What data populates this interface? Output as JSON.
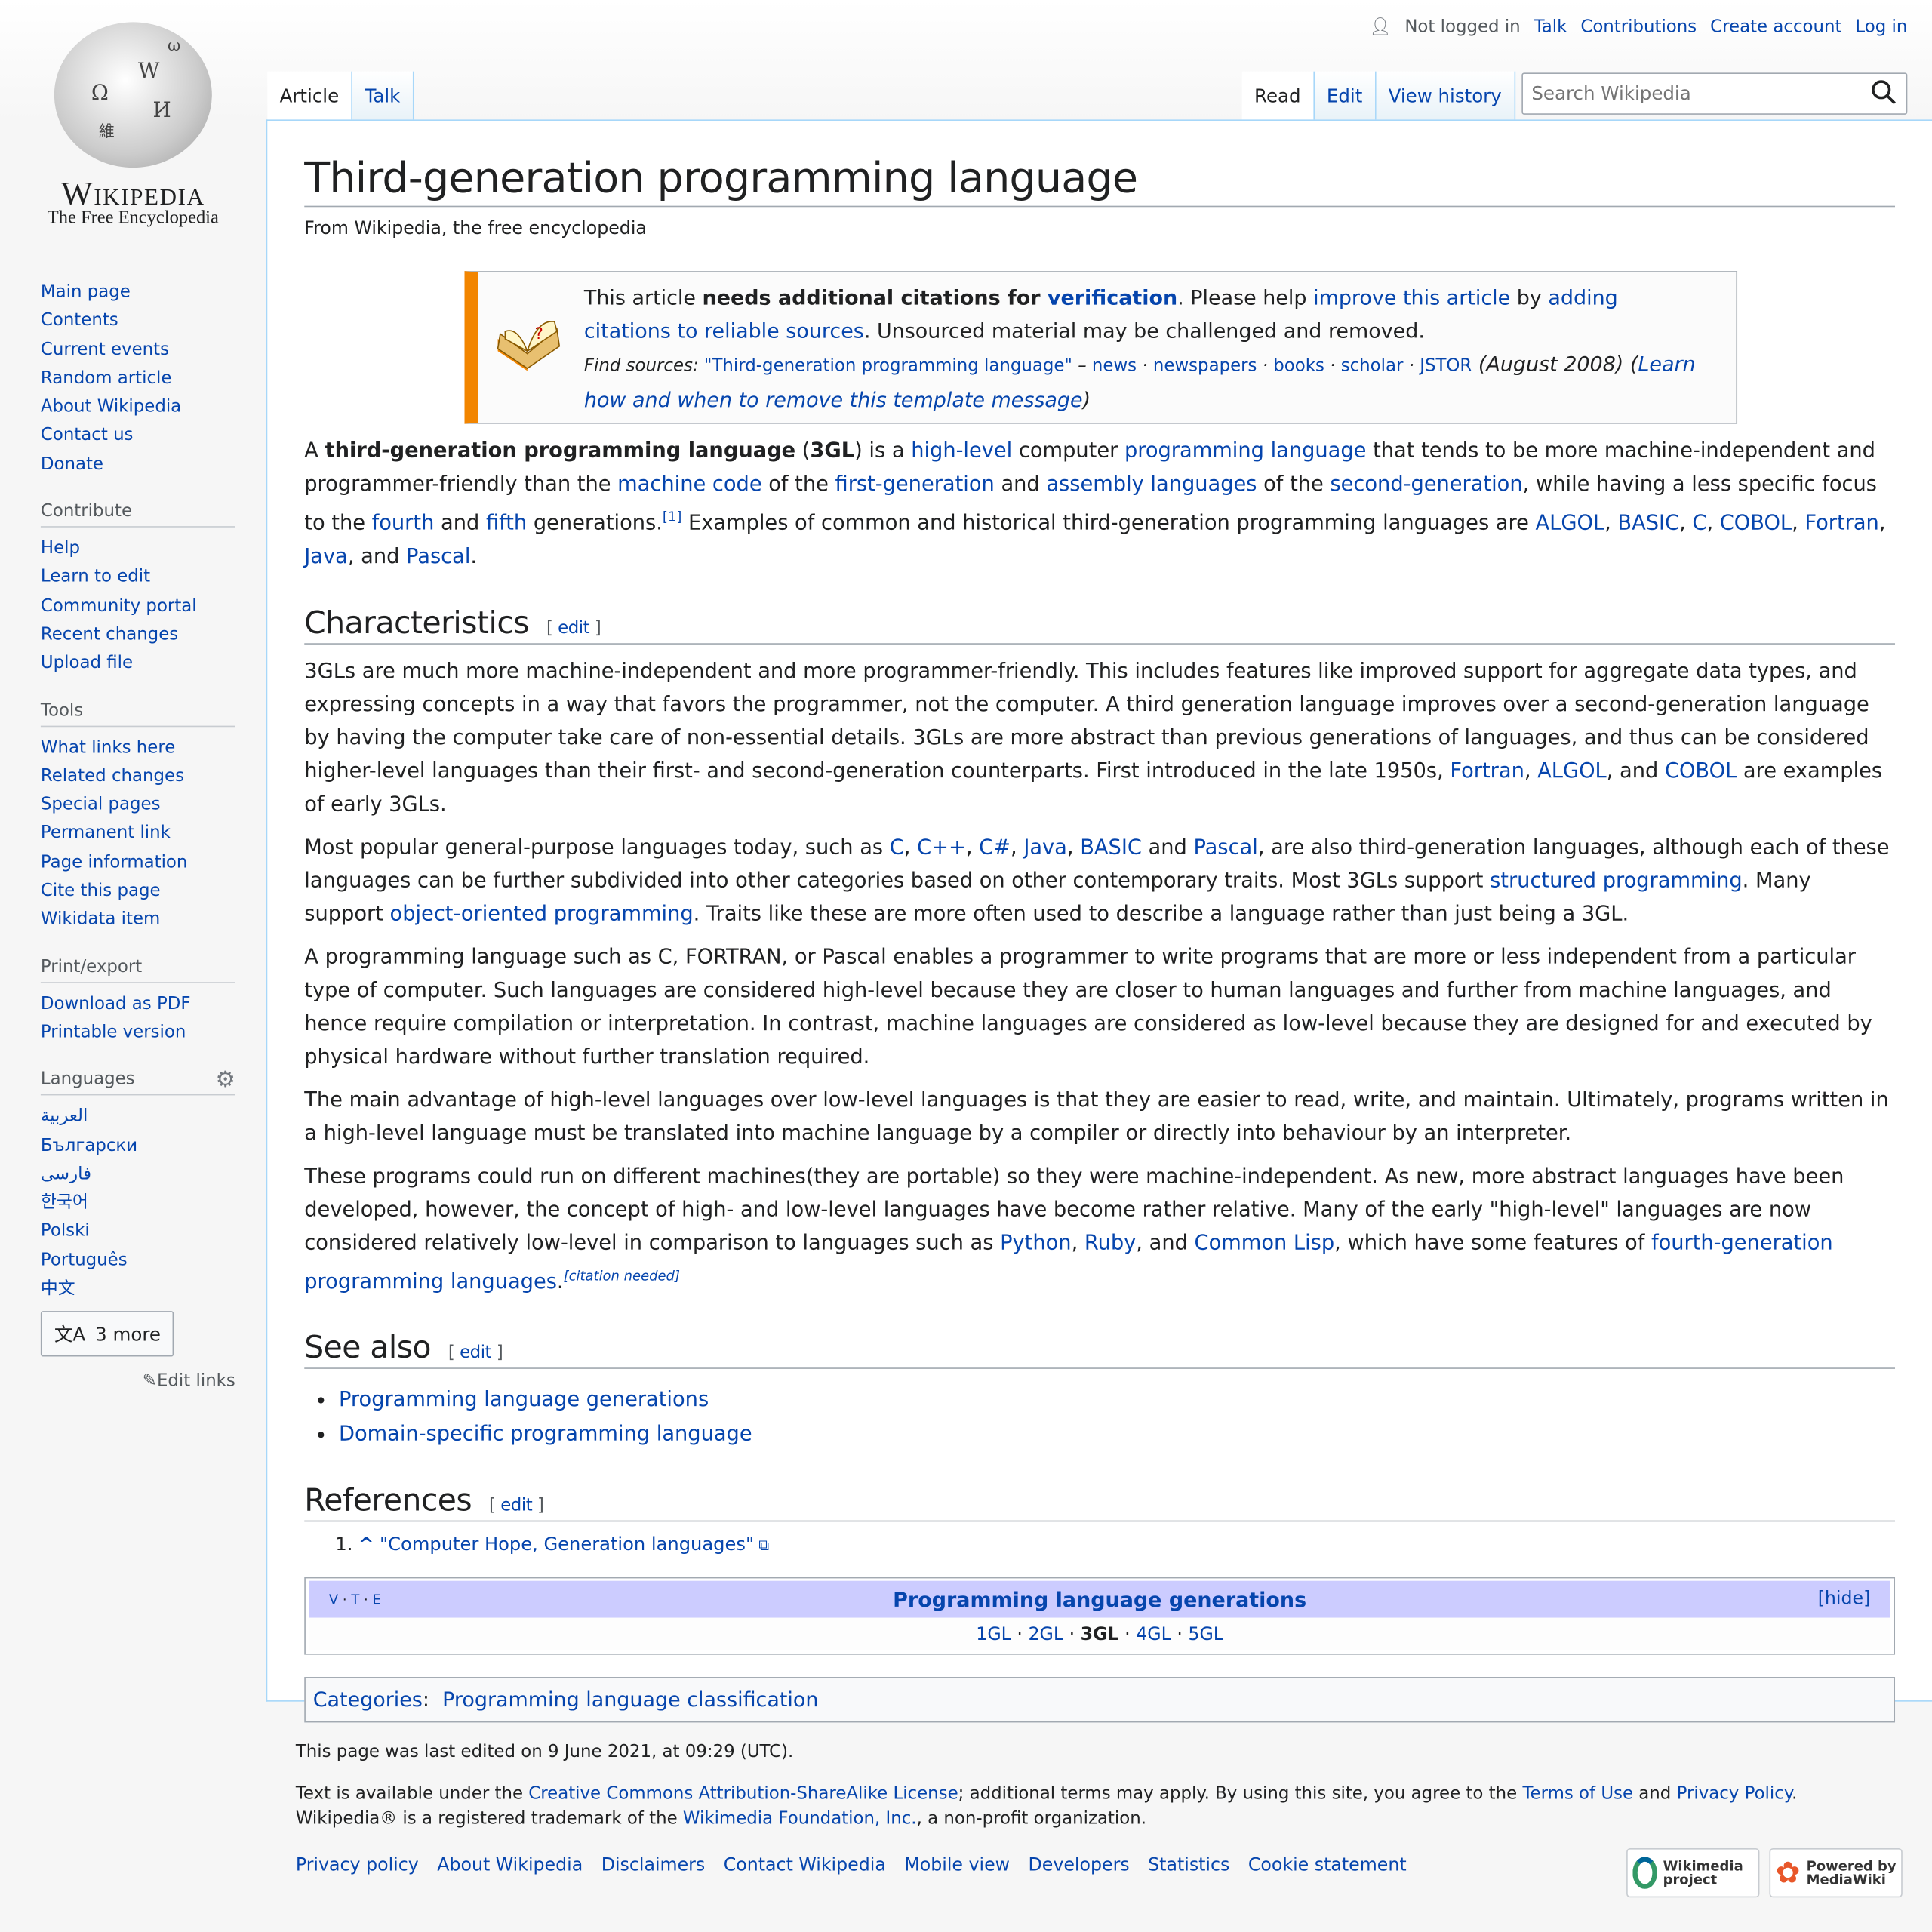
{
  "logo": {
    "wordmark": "Wikipedia",
    "tagline": "The Free Encyclopedia"
  },
  "personal": {
    "status": "Not logged in",
    "links": [
      "Talk",
      "Contributions",
      "Create account",
      "Log in"
    ]
  },
  "tabs": {
    "left": [
      "Article",
      "Talk"
    ],
    "right": [
      "Read",
      "Edit",
      "View history"
    ]
  },
  "search": {
    "placeholder": "Search Wikipedia"
  },
  "sidebar": {
    "nav": [
      "Main page",
      "Contents",
      "Current events",
      "Random article",
      "About Wikipedia",
      "Contact us",
      "Donate"
    ],
    "contribute": {
      "title": "Contribute",
      "items": [
        "Help",
        "Learn to edit",
        "Community portal",
        "Recent changes",
        "Upload file"
      ]
    },
    "tools": {
      "title": "Tools",
      "items": [
        "What links here",
        "Related changes",
        "Special pages",
        "Permanent link",
        "Page information",
        "Cite this page",
        "Wikidata item"
      ]
    },
    "print": {
      "title": "Print/export",
      "items": [
        "Download as PDF",
        "Printable version"
      ]
    },
    "languages": {
      "title": "Languages",
      "items": [
        "العربية",
        "Български",
        "فارسی",
        "한국어",
        "Polski",
        "Português",
        "中文"
      ],
      "more": "3 more",
      "edit_links": "Edit links"
    }
  },
  "page": {
    "title": "Third-generation programming language",
    "subtitle": "From Wikipedia, the free encyclopedia"
  },
  "ambox": {
    "line1": [
      [
        "This article ",
        ""
      ],
      [
        "needs additional citations for ",
        "b"
      ],
      [
        "verification",
        "bl"
      ],
      [
        ". Please help ",
        ""
      ],
      [
        "improve this article",
        "l"
      ],
      [
        " by ",
        ""
      ],
      [
        "adding citations to reliable sources",
        "l"
      ],
      [
        ". Unsourced material may be challenged and removed.",
        ""
      ]
    ],
    "line2": [
      [
        "Find sources: ",
        "si"
      ],
      [
        "\"Third-generation programming language\"",
        "sl"
      ],
      [
        " – ",
        "si"
      ],
      [
        "news",
        "sl"
      ],
      [
        " · ",
        "si"
      ],
      [
        "newspapers",
        "sl"
      ],
      [
        " · ",
        "si"
      ],
      [
        "books",
        "sl"
      ],
      [
        " · ",
        "si"
      ],
      [
        "scholar",
        "sl"
      ],
      [
        " · ",
        "si"
      ],
      [
        "JSTOR",
        "sl"
      ],
      [
        " (August 2008) (",
        "i"
      ],
      [
        "Learn how and when to remove this template message",
        "il"
      ],
      [
        ")",
        "i"
      ]
    ]
  },
  "content": {
    "intro": [
      [
        "A ",
        ""
      ],
      [
        "third-generation programming language",
        "b"
      ],
      [
        " (",
        ""
      ],
      [
        "3GL",
        "b"
      ],
      [
        ") is a ",
        ""
      ],
      [
        "high-level",
        "l"
      ],
      [
        " computer ",
        ""
      ],
      [
        "programming language",
        "l"
      ],
      [
        " that tends to be more machine-independent and programmer-friendly than the ",
        ""
      ],
      [
        "machine code",
        "l"
      ],
      [
        " of the ",
        ""
      ],
      [
        "first-generation",
        "l"
      ],
      [
        " and ",
        ""
      ],
      [
        "assembly languages",
        "l"
      ],
      [
        " of the ",
        ""
      ],
      [
        "second-generation",
        "l"
      ],
      [
        ", while having a less specific focus to the ",
        ""
      ],
      [
        "fourth",
        "l"
      ],
      [
        " and ",
        ""
      ],
      [
        "fifth",
        "l"
      ],
      [
        " generations.",
        ""
      ],
      [
        "[1]",
        "s"
      ],
      [
        " Examples of common and historical third-generation programming languages are ",
        ""
      ],
      [
        "ALGOL",
        "l"
      ],
      [
        ", ",
        ""
      ],
      [
        "BASIC",
        "l"
      ],
      [
        ", ",
        ""
      ],
      [
        "C",
        "l"
      ],
      [
        ", ",
        ""
      ],
      [
        "COBOL",
        "l"
      ],
      [
        ", ",
        ""
      ],
      [
        "Fortran",
        "l"
      ],
      [
        ", ",
        ""
      ],
      [
        "Java",
        "l"
      ],
      [
        ", and ",
        ""
      ],
      [
        "Pascal",
        "l"
      ],
      [
        ".",
        ""
      ]
    ],
    "characteristics_heading": "Characteristics",
    "edit_label": "edit",
    "char_paras": [
      [
        [
          "3GLs are much more machine-independent and more programmer-friendly. This includes features like improved support for aggregate data types, and expressing concepts in a way that favors the programmer, not the computer. A third generation language improves over a second-generation language by having the computer take care of non-essential details. 3GLs are more abstract than previous generations of languages, and thus can be considered higher-level languages than their first- and second-generation counterparts. First introduced in the late 1950s, ",
          ""
        ],
        [
          "Fortran",
          "l"
        ],
        [
          ", ",
          ""
        ],
        [
          "ALGOL",
          "l"
        ],
        [
          ", and ",
          ""
        ],
        [
          "COBOL",
          "l"
        ],
        [
          " are examples of early 3GLs.",
          ""
        ]
      ],
      [
        [
          "Most popular general-purpose languages today, such as ",
          ""
        ],
        [
          "C",
          "l"
        ],
        [
          ", ",
          ""
        ],
        [
          "C++",
          "l"
        ],
        [
          ", ",
          ""
        ],
        [
          "C#",
          "l"
        ],
        [
          ", ",
          ""
        ],
        [
          "Java",
          "l"
        ],
        [
          ", ",
          ""
        ],
        [
          "BASIC",
          "l"
        ],
        [
          " and ",
          ""
        ],
        [
          "Pascal",
          "l"
        ],
        [
          ", are also third-generation languages, although each of these languages can be further subdivided into other categories based on other contemporary traits. Most 3GLs support ",
          ""
        ],
        [
          "structured programming",
          "l"
        ],
        [
          ". Many support ",
          ""
        ],
        [
          "object-oriented programming",
          "l"
        ],
        [
          ". Traits like these are more often used to describe a language rather than just being a 3GL.",
          ""
        ]
      ],
      [
        [
          "A programming language such as C, FORTRAN, or Pascal enables a programmer to write programs that are more or less independent from a particular type of computer. Such languages are considered high-level because they are closer to human languages and further from machine languages, and hence require compilation or interpretation. In contrast, machine languages are considered as low-level because they are designed for and executed by physical hardware without further translation required.",
          ""
        ]
      ],
      [
        [
          "The main advantage of high-level languages over low-level languages is that they are easier to read, write, and maintain. Ultimately, programs written in a high-level language must be translated into machine language by a compiler or directly into behaviour by an interpreter.",
          ""
        ]
      ],
      [
        [
          "These programs could run on different machines(they are portable) so they were machine-independent. As new, more abstract languages have been developed, however, the concept of high- and low-level languages have become rather relative. Many of the early \"high-level\" languages are now considered relatively low-level in comparison to languages such as ",
          ""
        ],
        [
          "Python",
          "l"
        ],
        [
          ", ",
          ""
        ],
        [
          "Ruby",
          "l"
        ],
        [
          ", and ",
          ""
        ],
        [
          "Common Lisp",
          "l"
        ],
        [
          ", which have some features of ",
          ""
        ],
        [
          "fourth-generation programming languages",
          "l"
        ],
        [
          ".",
          ""
        ],
        [
          "[citation needed]",
          "cn"
        ]
      ]
    ],
    "see_also_heading": "See also",
    "see_also": [
      "Programming language generations",
      "Domain-specific programming language"
    ],
    "references_heading": "References",
    "references": [
      {
        "caret": "^",
        "text": "\"Computer Hope, Generation languages\""
      }
    ],
    "navbox": {
      "vte": [
        "V",
        "T",
        "E"
      ],
      "title": "Programming language generations",
      "hide": "[hide]",
      "items": [
        "1GL",
        "2GL",
        "3GL",
        "4GL",
        "5GL"
      ],
      "current": "3GL"
    },
    "categories": {
      "label": "Categories",
      "items": [
        "Programming language classification"
      ]
    }
  },
  "footer": {
    "last_edited": "This page was last edited on 9 June 2021, at 09:29 (UTC).",
    "license": [
      [
        "Text is available under the ",
        ""
      ],
      [
        "Creative Commons Attribution-ShareAlike License",
        "l"
      ],
      [
        "; additional terms may apply. By using this site, you agree to the ",
        ""
      ],
      [
        "Terms of Use",
        "l"
      ],
      [
        " and ",
        ""
      ],
      [
        "Privacy Policy",
        "l"
      ],
      [
        ". Wikipedia® is a registered trademark of the ",
        ""
      ],
      [
        "Wikimedia Foundation, Inc.",
        "l"
      ],
      [
        ", a non-profit organization.",
        ""
      ]
    ],
    "links": [
      "Privacy policy",
      "About Wikipedia",
      "Disclaimers",
      "Contact Wikipedia",
      "Mobile view",
      "Developers",
      "Statistics",
      "Cookie statement"
    ],
    "badges": {
      "wikimedia": "Wikimedia project",
      "mediawiki": "Powered by MediaWiki"
    }
  },
  "colors": {
    "link": "#0645ad",
    "ambox_stripe": "#f28500",
    "navbox_header": "#ccccff",
    "border": "#a7d7f9"
  }
}
